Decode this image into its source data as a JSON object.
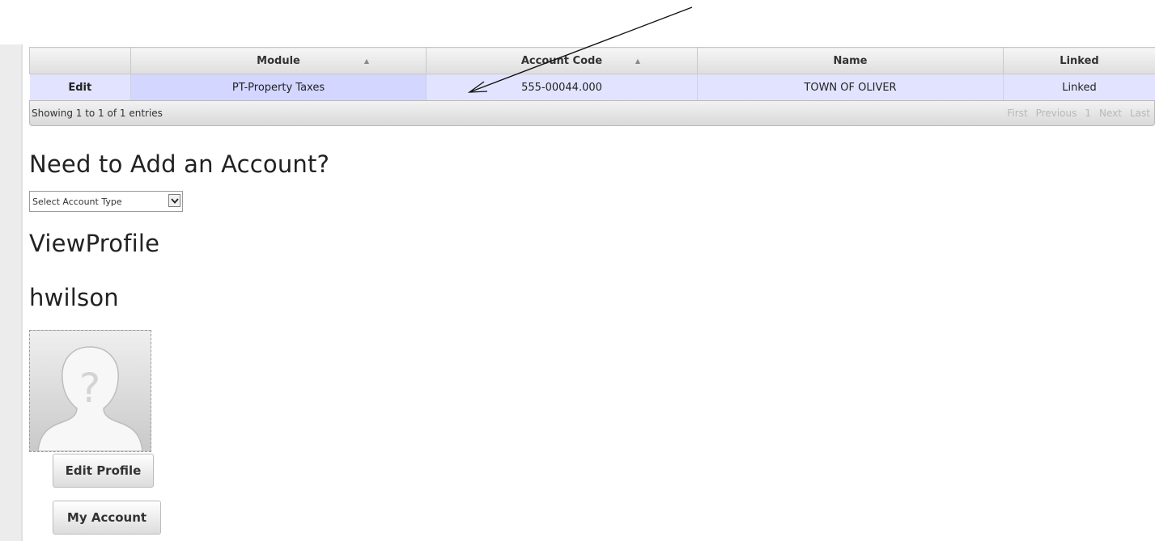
{
  "table": {
    "columns": [
      {
        "label": ""
      },
      {
        "label": "Module"
      },
      {
        "label": "Account Code"
      },
      {
        "label": "Name"
      },
      {
        "label": "Linked"
      }
    ],
    "rows": [
      {
        "action": "Edit",
        "module": "PT-Property Taxes",
        "account_code": "555-00044.000",
        "name": "TOWN OF OLIVER",
        "linked": "Linked"
      }
    ],
    "info": "Showing 1 to 1 of 1 entries",
    "pager": {
      "first": "First",
      "previous": "Previous",
      "page": "1",
      "next": "Next",
      "last": "Last"
    }
  },
  "add_account": {
    "title": "Need to Add an Account?",
    "select_value": "Select Account Type"
  },
  "profile": {
    "title": "ViewProfile",
    "username": "hwilson",
    "edit_button": "Edit Profile",
    "account_button": "My Account"
  },
  "colors": {
    "row_bg": "#e2e4ff",
    "row_highlight": "#d3d6ff"
  },
  "icons": {
    "sort": "sort-asc-icon",
    "dropdown": "chevron-down-icon",
    "avatar": "default-avatar-icon",
    "annotation": "arrow-annotation"
  }
}
